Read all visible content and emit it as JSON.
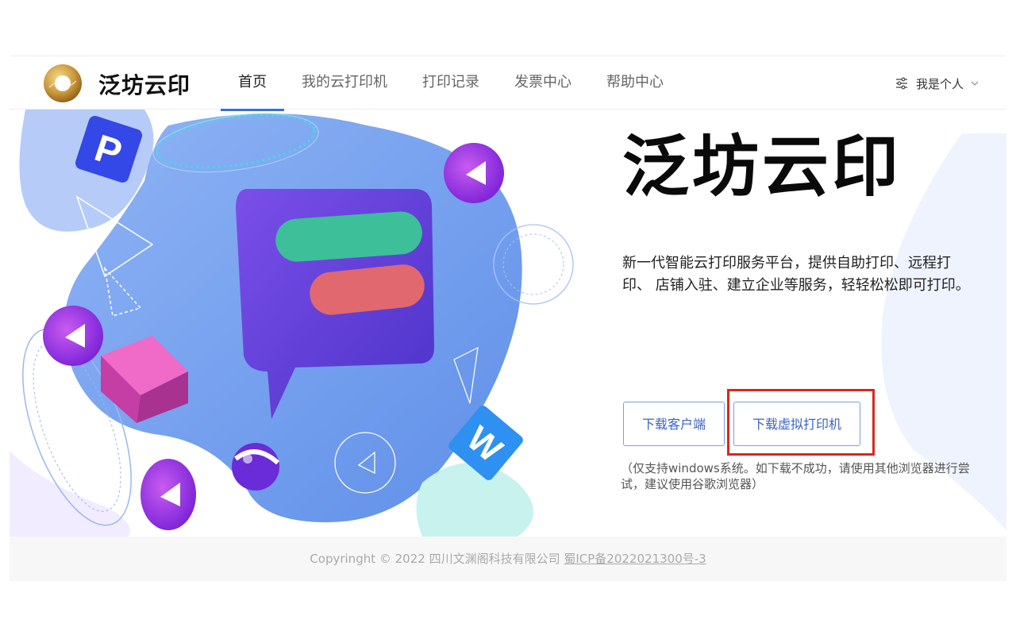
{
  "header": {
    "brand": "泛坊云印",
    "nav": [
      {
        "label": "首页",
        "active": true
      },
      {
        "label": "我的云打印机"
      },
      {
        "label": "打印记录"
      },
      {
        "label": "发票中心"
      },
      {
        "label": "帮助中心"
      }
    ],
    "user_menu": {
      "label": "我是个人",
      "icon": "sliders-icon",
      "caret": "chevron-down-icon"
    }
  },
  "hero": {
    "title": "泛坊云印",
    "description": "新一代智能云打印服务平台，提供自助打印、远程打印、 店铺入驻、建立企业等服务，轻轻松松即可打印。",
    "buttons": {
      "download_client": "下载客户端",
      "download_virtual_printer": "下载虚拟打印机"
    },
    "note": "（仅支持windows系统。如下载不成功，请使用其他浏览器进行尝试，建议使用谷歌浏览器）",
    "illustration_letters": {
      "p_badge": "P",
      "w_badge": "W"
    }
  },
  "footer": {
    "copyright": "Copyringht © 2022 四川文渊阁科技有限公司",
    "icp": "蜀ICP备2022021300号-3"
  },
  "colors": {
    "accent": "#3a6fd8",
    "button_text": "#3a64c8",
    "highlight": "#d8281e",
    "blob": "#6e9cf0",
    "bubble": "#5b3fd6",
    "green_bar": "#3dbf9a",
    "red_bar": "#e0686e"
  }
}
